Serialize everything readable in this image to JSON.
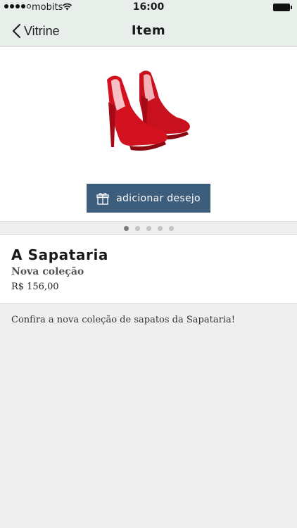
{
  "status_bar": {
    "carrier": "mobits",
    "time": "16:00",
    "signal_icon": "signal-dots-icon",
    "wifi_icon": "wifi-icon",
    "battery_icon": "battery-icon"
  },
  "nav": {
    "back_label": "Vitrine",
    "title": "Item",
    "bar_color": "#e8efea"
  },
  "product": {
    "image_icon": "red-high-heel-shoes",
    "wish_button_label": "adicionar desejo",
    "wish_button_icon": "gift-icon",
    "wish_button_color": "#3d5d7c",
    "carousel": {
      "page_count": 5,
      "active_index": 0
    }
  },
  "info": {
    "store_name": "A Sapataria",
    "collection": "Nova coleção",
    "currency": "R$",
    "price": "156,00"
  },
  "description": "Confira a nova coleção de sapatos da Sapataria!"
}
